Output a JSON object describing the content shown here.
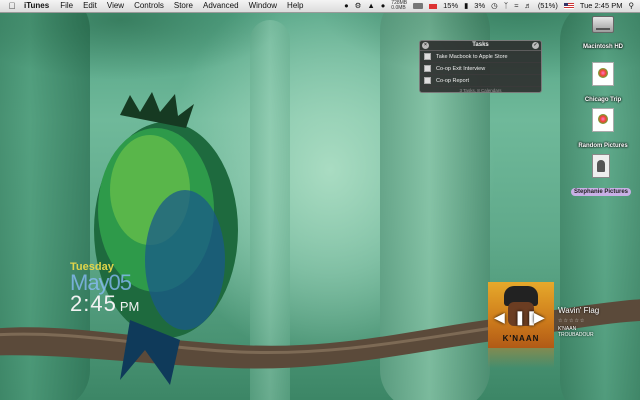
{
  "menubar": {
    "app_name": "iTunes",
    "items": [
      "File",
      "Edit",
      "View",
      "Controls",
      "Store",
      "Advanced",
      "Window",
      "Help"
    ],
    "status": {
      "memory_top": "728MB",
      "memory_bottom": "0.0MB",
      "cpu_percent": "15%",
      "cpu2_percent": "3%",
      "battery": "(51%)",
      "clock": "Tue 2:45 PM"
    }
  },
  "tasks_widget": {
    "title": "Tasks",
    "items": [
      "Take Macbook to Apple Store",
      "Co-op Exit Interview",
      "Co-op Report"
    ],
    "footer": "3 Tasks, 8 Calendars"
  },
  "desktop_icons": [
    {
      "label": "Macintosh HD",
      "icon": "hard-drive-icon"
    },
    {
      "label": "Chicago Trip",
      "icon": "photo-file-icon"
    },
    {
      "label": "Random Pictures",
      "icon": "photo-file-icon"
    },
    {
      "label": "Stephanie Pictures",
      "icon": "image-file-icon",
      "selected": true
    }
  ],
  "clock_widget": {
    "day": "Tuesday",
    "date": "May05",
    "time": "2:45",
    "ampm": "PM"
  },
  "now_playing": {
    "title": "Wavin' Flag",
    "stars": "☆☆☆☆☆",
    "artist": "K'NAAN",
    "album": "TROUBADOUR",
    "album_art_text": "K'NAAN"
  },
  "colors": {
    "clock_day": "#e0d44a",
    "selection": "#c9b0e6",
    "wallpaper": "#3f8a6e"
  }
}
